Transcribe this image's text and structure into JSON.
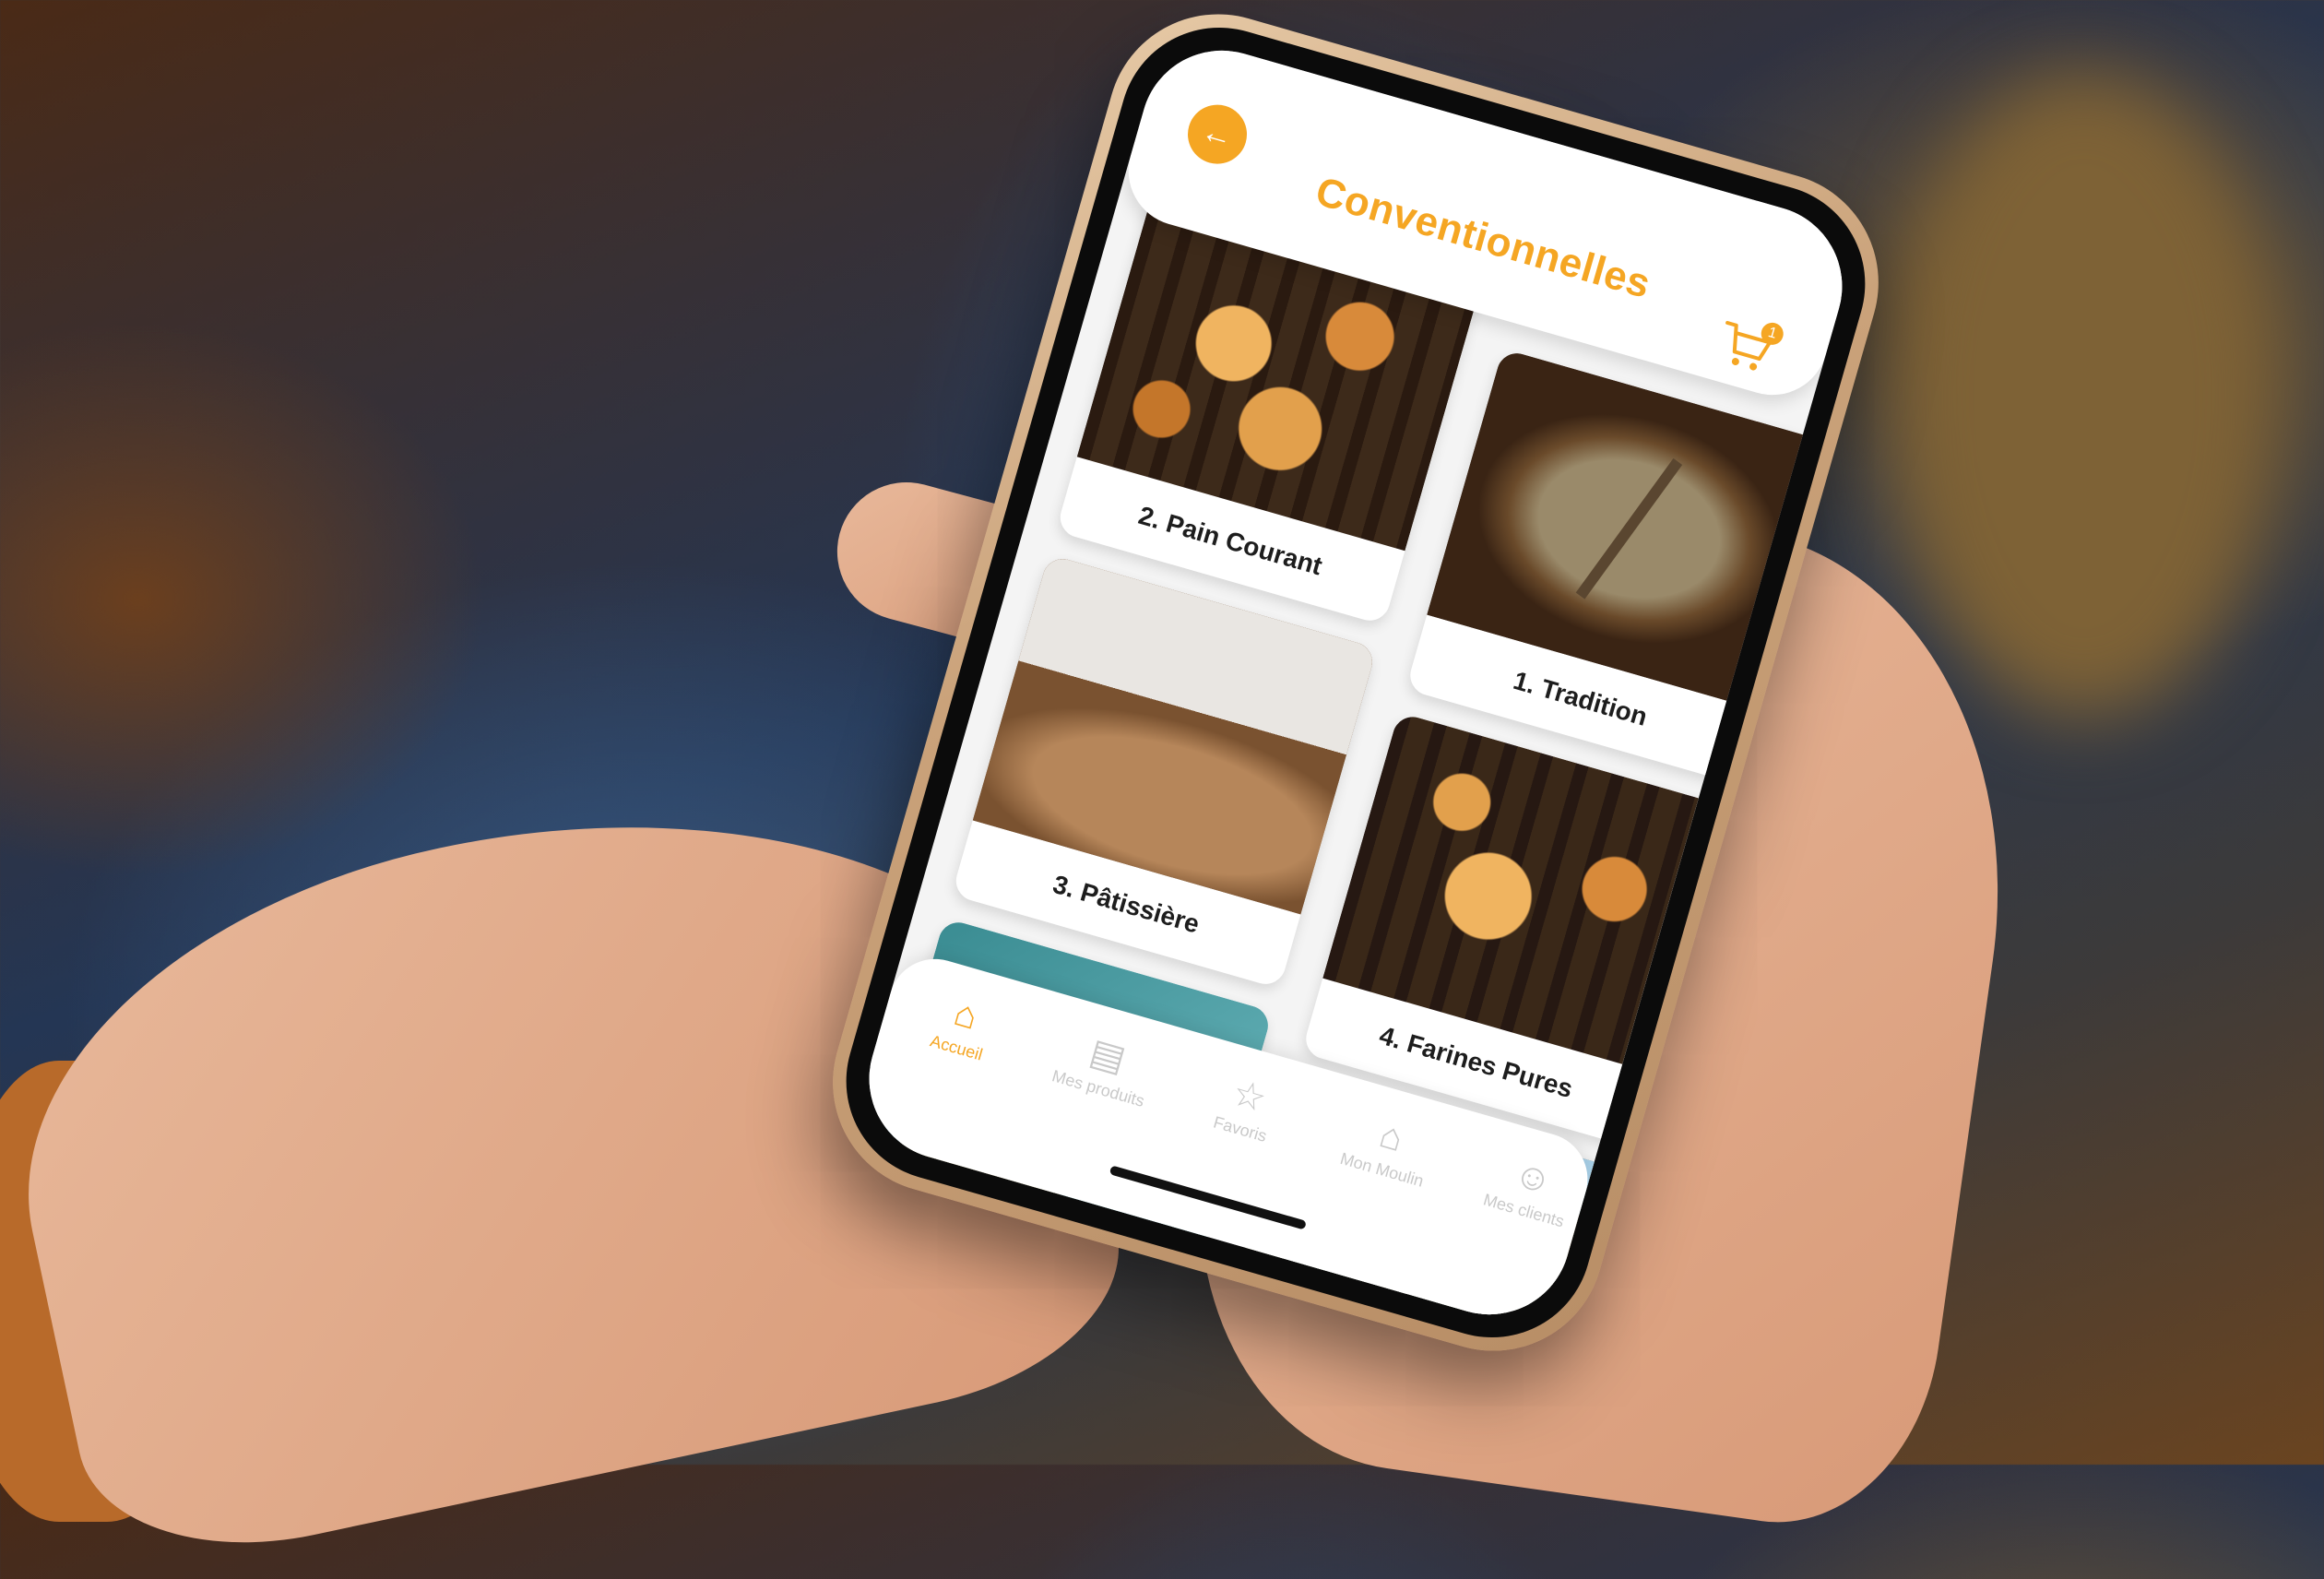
{
  "header": {
    "title": "Conventionnelles",
    "back_icon": "arrow-left-icon",
    "cart_icon": "cart-icon",
    "cart_count": "1"
  },
  "categories": [
    {
      "label": "2. Pain Courant",
      "image": "bread-on-rack-photo"
    },
    {
      "label": "1. Tradition",
      "image": "scored-loaf-photo"
    },
    {
      "label": "3. Pâtissière",
      "image": "sliced-bread-photo"
    },
    {
      "label": "4. Farines Pures",
      "image": "bread-on-rack-photo"
    },
    {
      "label": "",
      "image": "seeds-on-flour-photo"
    },
    {
      "label": "",
      "image": "bread-crumb-photo"
    }
  ],
  "tabbar": {
    "items": [
      {
        "label": "Accueil",
        "icon": "home-icon",
        "active": true
      },
      {
        "label": "Mes produits",
        "icon": "bag-icon",
        "active": false
      },
      {
        "label": "Favoris",
        "icon": "star-icon",
        "active": false
      },
      {
        "label": "Mon Moulin",
        "icon": "store-icon",
        "active": false
      },
      {
        "label": "Mes clients",
        "icon": "user-icon",
        "active": false
      }
    ]
  },
  "colors": {
    "accent": "#f5a623",
    "tab_inactive": "#c9c9c9",
    "screen_bg": "#f4f4f4"
  }
}
